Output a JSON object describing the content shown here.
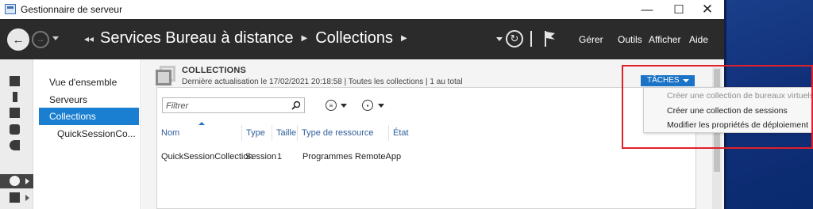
{
  "window": {
    "title": "Gestionnaire de serveur",
    "min": "—",
    "max": "☐",
    "close": "✕"
  },
  "header": {
    "lead": "◂◂",
    "breadcrumb": [
      "Services Bureau à distance",
      "Collections"
    ],
    "menus": [
      "Gérer",
      "Outils",
      "Afficher",
      "Aide"
    ]
  },
  "sidebar": {
    "rail_icons": [
      "dashboard-icon",
      "local-server-icon",
      "all-servers-icon",
      "ad-ds-icon",
      "file-services-icon",
      "remote-desktop-icon",
      "more-roles-icon"
    ],
    "items": [
      {
        "label": "Vue d'ensemble"
      },
      {
        "label": "Serveurs"
      },
      {
        "label": "Collections"
      },
      {
        "label": "QuickSessionCo..."
      }
    ]
  },
  "pane": {
    "title": "COLLECTIONS",
    "subtitle": "Dernière actualisation le 17/02/2021 20:18:58 | Toutes les collections | 1 au total",
    "tasks_label": "TÂCHES"
  },
  "filter": {
    "placeholder": "Filtrer"
  },
  "table": {
    "columns": [
      "Nom",
      "Type",
      "Taille",
      "Type de ressource",
      "État"
    ],
    "rows": [
      [
        "QuickSessionCollection",
        "Session",
        "1",
        "Programmes RemoteApp",
        ""
      ]
    ]
  },
  "tasks_menu": {
    "items": [
      {
        "label": "Créer une collection de bureaux virtuels",
        "enabled": false
      },
      {
        "label": "Créer une collection de sessions",
        "enabled": true
      },
      {
        "label": "Modifier les propriétés de déploiement",
        "enabled": true
      }
    ]
  },
  "colors": {
    "header_bg": "#2b2b2b",
    "accent": "#1a7fd0",
    "highlight": "#e0202a"
  }
}
